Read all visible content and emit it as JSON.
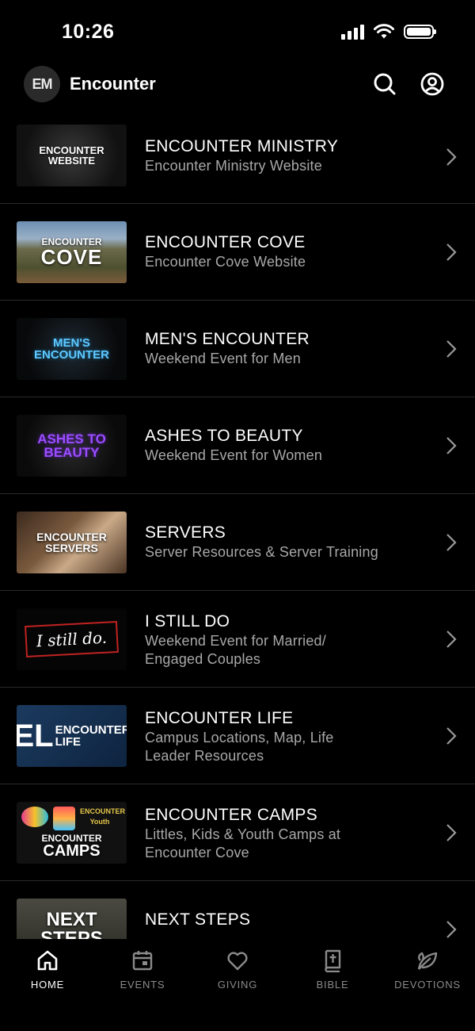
{
  "status": {
    "time": "10:26"
  },
  "header": {
    "title": "Encounter",
    "logo_text": "EM"
  },
  "items": [
    {
      "title": "ENCOUNTER MINISTRY",
      "subtitle": "Encounter Ministry Website",
      "thumb": [
        "ENCOUNTER",
        "WEBSITE"
      ]
    },
    {
      "title": "ENCOUNTER COVE",
      "subtitle": "Encounter Cove Website",
      "thumb": [
        "ENCOUNTER",
        "COVE"
      ]
    },
    {
      "title": "MEN'S ENCOUNTER",
      "subtitle": "Weekend Event for Men",
      "thumb": [
        "MEN'S",
        "ENCOUNTER"
      ]
    },
    {
      "title": "ASHES TO BEAUTY",
      "subtitle": "Weekend Event for Women",
      "thumb": [
        "ASHES TO",
        "BEAUTY"
      ]
    },
    {
      "title": "SERVERS",
      "subtitle": "Server Resources & Server Training",
      "thumb": [
        "ENCOUNTER",
        "SERVERS"
      ]
    },
    {
      "title": "I STILL DO",
      "subtitle": "Weekend Event for Married/ Engaged Couples",
      "thumb": [
        "I still do."
      ]
    },
    {
      "title": "ENCOUNTER LIFE",
      "subtitle": "Campus Locations, Map, Life Leader Resources",
      "thumb": [
        "ENCOUNTER",
        "LIFE"
      ]
    },
    {
      "title": "ENCOUNTER CAMPS",
      "subtitle": "Littles, Kids & Youth Camps at Encounter Cove",
      "thumb": [
        "ENCOUNTER",
        "CAMPS"
      ]
    },
    {
      "title": "NEXT STEPS",
      "subtitle": "",
      "thumb": [
        "NEXT",
        "STEPS"
      ]
    }
  ],
  "tabs": [
    {
      "label": "HOME",
      "icon": "home-icon",
      "active": true
    },
    {
      "label": "EVENTS",
      "icon": "calendar-icon"
    },
    {
      "label": "GIVING",
      "icon": "heart-icon"
    },
    {
      "label": "BIBLE",
      "icon": "bible-icon"
    },
    {
      "label": "DEVOTIONS",
      "icon": "leaf-icon"
    }
  ]
}
